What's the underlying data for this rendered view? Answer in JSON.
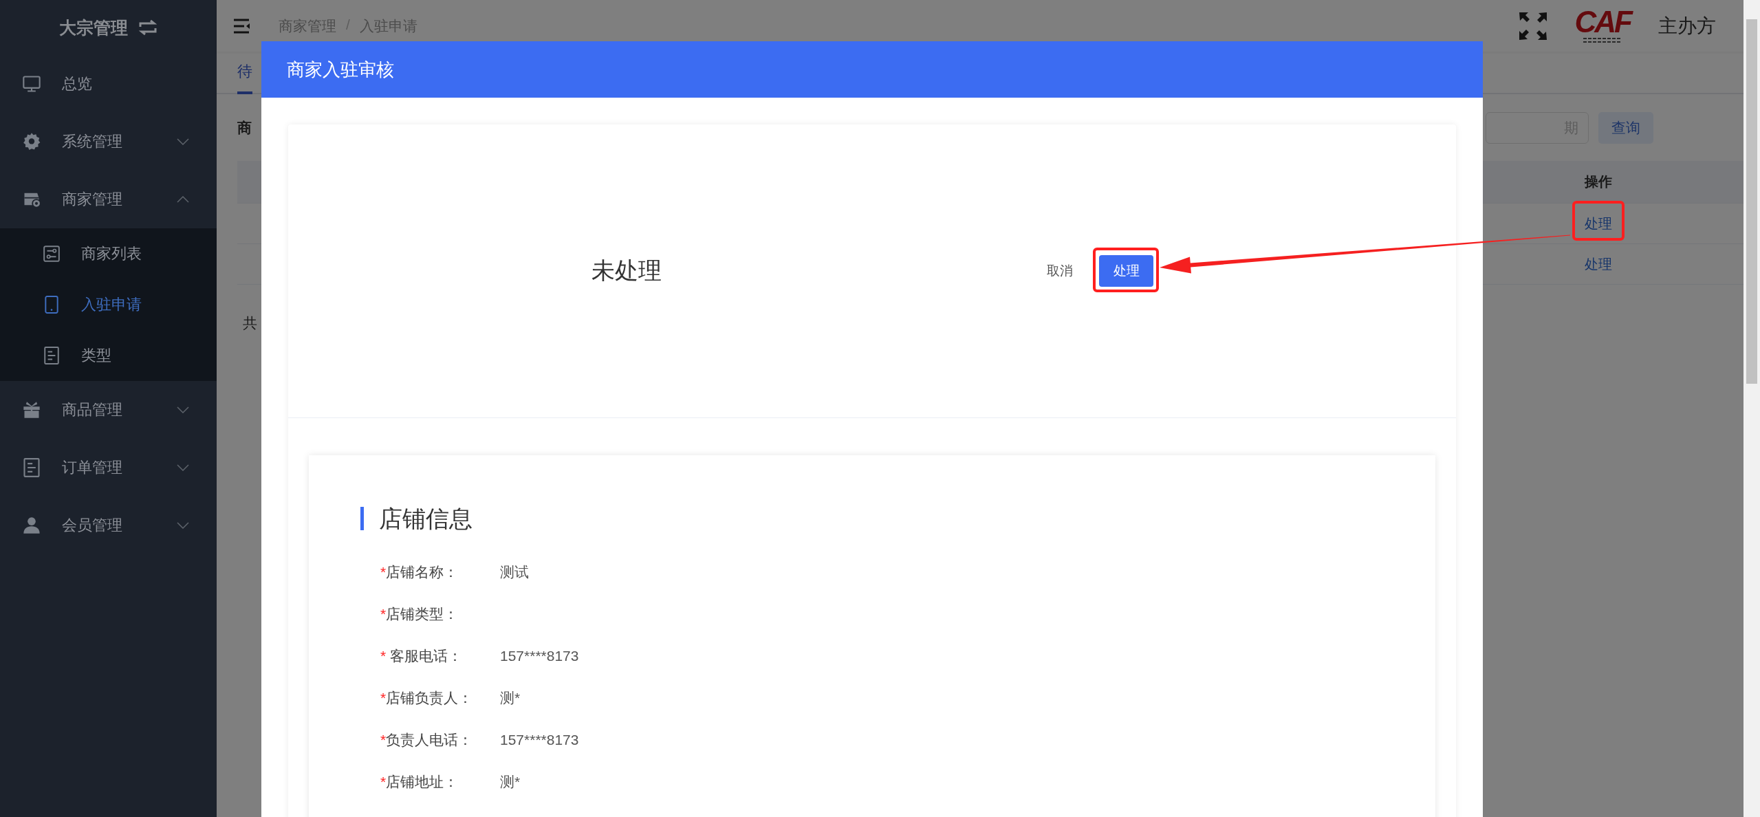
{
  "sidebar": {
    "title": "大宗管理",
    "items": [
      {
        "label": "总览",
        "kind": "link"
      },
      {
        "label": "系统管理",
        "kind": "menu",
        "expanded": false
      },
      {
        "label": "商家管理",
        "kind": "menu",
        "expanded": true,
        "children": [
          {
            "label": "商家列表",
            "selected": false
          },
          {
            "label": "入驻申请",
            "selected": true
          },
          {
            "label": "类型",
            "selected": false
          }
        ]
      },
      {
        "label": "商品管理",
        "kind": "menu",
        "expanded": false
      },
      {
        "label": "订单管理",
        "kind": "menu",
        "expanded": false
      },
      {
        "label": "会员管理",
        "kind": "menu",
        "expanded": false
      }
    ]
  },
  "header": {
    "breadcrumb": [
      "商家管理",
      "入驻申请"
    ],
    "separator": "/",
    "logo_text": "CAF",
    "organizer": "主办方"
  },
  "list_page": {
    "tabs": [
      {
        "label": "待",
        "selected": true
      }
    ],
    "filter_label": "商",
    "date_placeholder": "期",
    "query_button": "查询",
    "table": {
      "columns": [
        {
          "label": "操作"
        }
      ],
      "rows": [
        {
          "action": "处理"
        },
        {
          "action": "处理"
        }
      ]
    },
    "total": "共"
  },
  "modal": {
    "title": "商家入驻审核",
    "status": "未处理",
    "cancel_button": "取消",
    "confirm_button": "处理",
    "section": {
      "title": "店铺信息",
      "fields": [
        {
          "mark": "*",
          "label": "店铺名称：",
          "value": "测试"
        },
        {
          "mark": "*",
          "label": "店铺类型："
        },
        {
          "mark": "*",
          "label": " 客服电话：",
          "value": "157****8173"
        },
        {
          "mark": "*",
          "label": "店铺负责人：",
          "value": "测*"
        },
        {
          "mark": "*",
          "label": "负责人电话：",
          "value": "157****8173"
        },
        {
          "mark": "*",
          "label": "店铺地址：",
          "value": "测*"
        }
      ]
    }
  }
}
